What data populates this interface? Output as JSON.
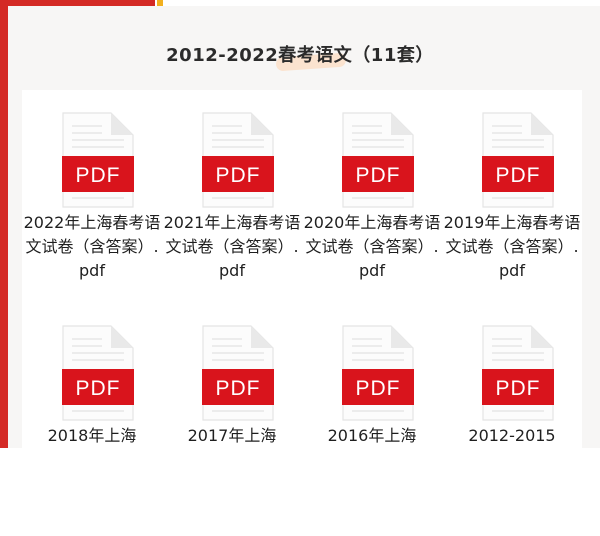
{
  "header": {
    "title": "2012-2022春考语文（11套）"
  },
  "colors": {
    "accent_red": "#d42a25",
    "accent_yellow": "#f2b01e",
    "pdf_red": "#d9141c",
    "title_highlight": "#fbe3cf"
  },
  "files": [
    {
      "label": "PDF",
      "name": "2022年上海春考语文试卷（含答案）.pdf",
      "icon": "pdf-file-icon"
    },
    {
      "label": "PDF",
      "name": "2021年上海春考语文试卷（含答案）.pdf",
      "icon": "pdf-file-icon"
    },
    {
      "label": "PDF",
      "name": "2020年上海春考语文试卷（含答案）.pdf",
      "icon": "pdf-file-icon"
    },
    {
      "label": "PDF",
      "name": "2019年上海春考语文试卷（含答案）.pdf",
      "icon": "pdf-file-icon"
    },
    {
      "label": "PDF",
      "name": "2018年上海",
      "icon": "pdf-file-icon"
    },
    {
      "label": "PDF",
      "name": "2017年上海",
      "icon": "pdf-file-icon"
    },
    {
      "label": "PDF",
      "name": "2016年上海",
      "icon": "pdf-file-icon"
    },
    {
      "label": "PDF",
      "name": "2012-2015",
      "icon": "pdf-file-icon"
    }
  ]
}
